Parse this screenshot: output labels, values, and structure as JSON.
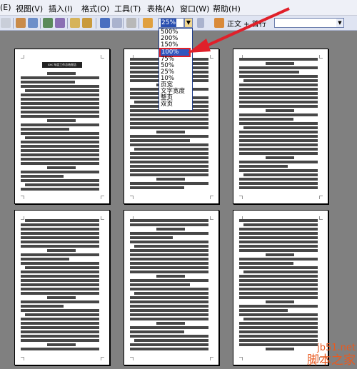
{
  "menu": {
    "items": [
      "(E)",
      "视图(V)",
      "插入(I)",
      "格式(O)",
      "工具(T)",
      "表格(A)",
      "窗口(W)",
      "帮助(H)"
    ]
  },
  "toolbar": {
    "zoom_value": "25%",
    "style_label": "正文 + 首行"
  },
  "zoom_dropdown": {
    "options": [
      "500%",
      "200%",
      "150%",
      "100%",
      "75%",
      "50%",
      "25%",
      "10%",
      "页宽",
      "文字宽度",
      "整页",
      "双页"
    ],
    "highlighted": "100%"
  },
  "document": {
    "title_snippet": "xxx 年度工作总结报告"
  },
  "watermark": {
    "url": "jb51.net",
    "site": "脚本之家"
  },
  "colors": {
    "menubar": "#eef0f7",
    "toolbar": "#dfe4f2",
    "workspace": "#808080",
    "highlight": "#3157c0",
    "annotation_arrow": "#e0202a"
  }
}
